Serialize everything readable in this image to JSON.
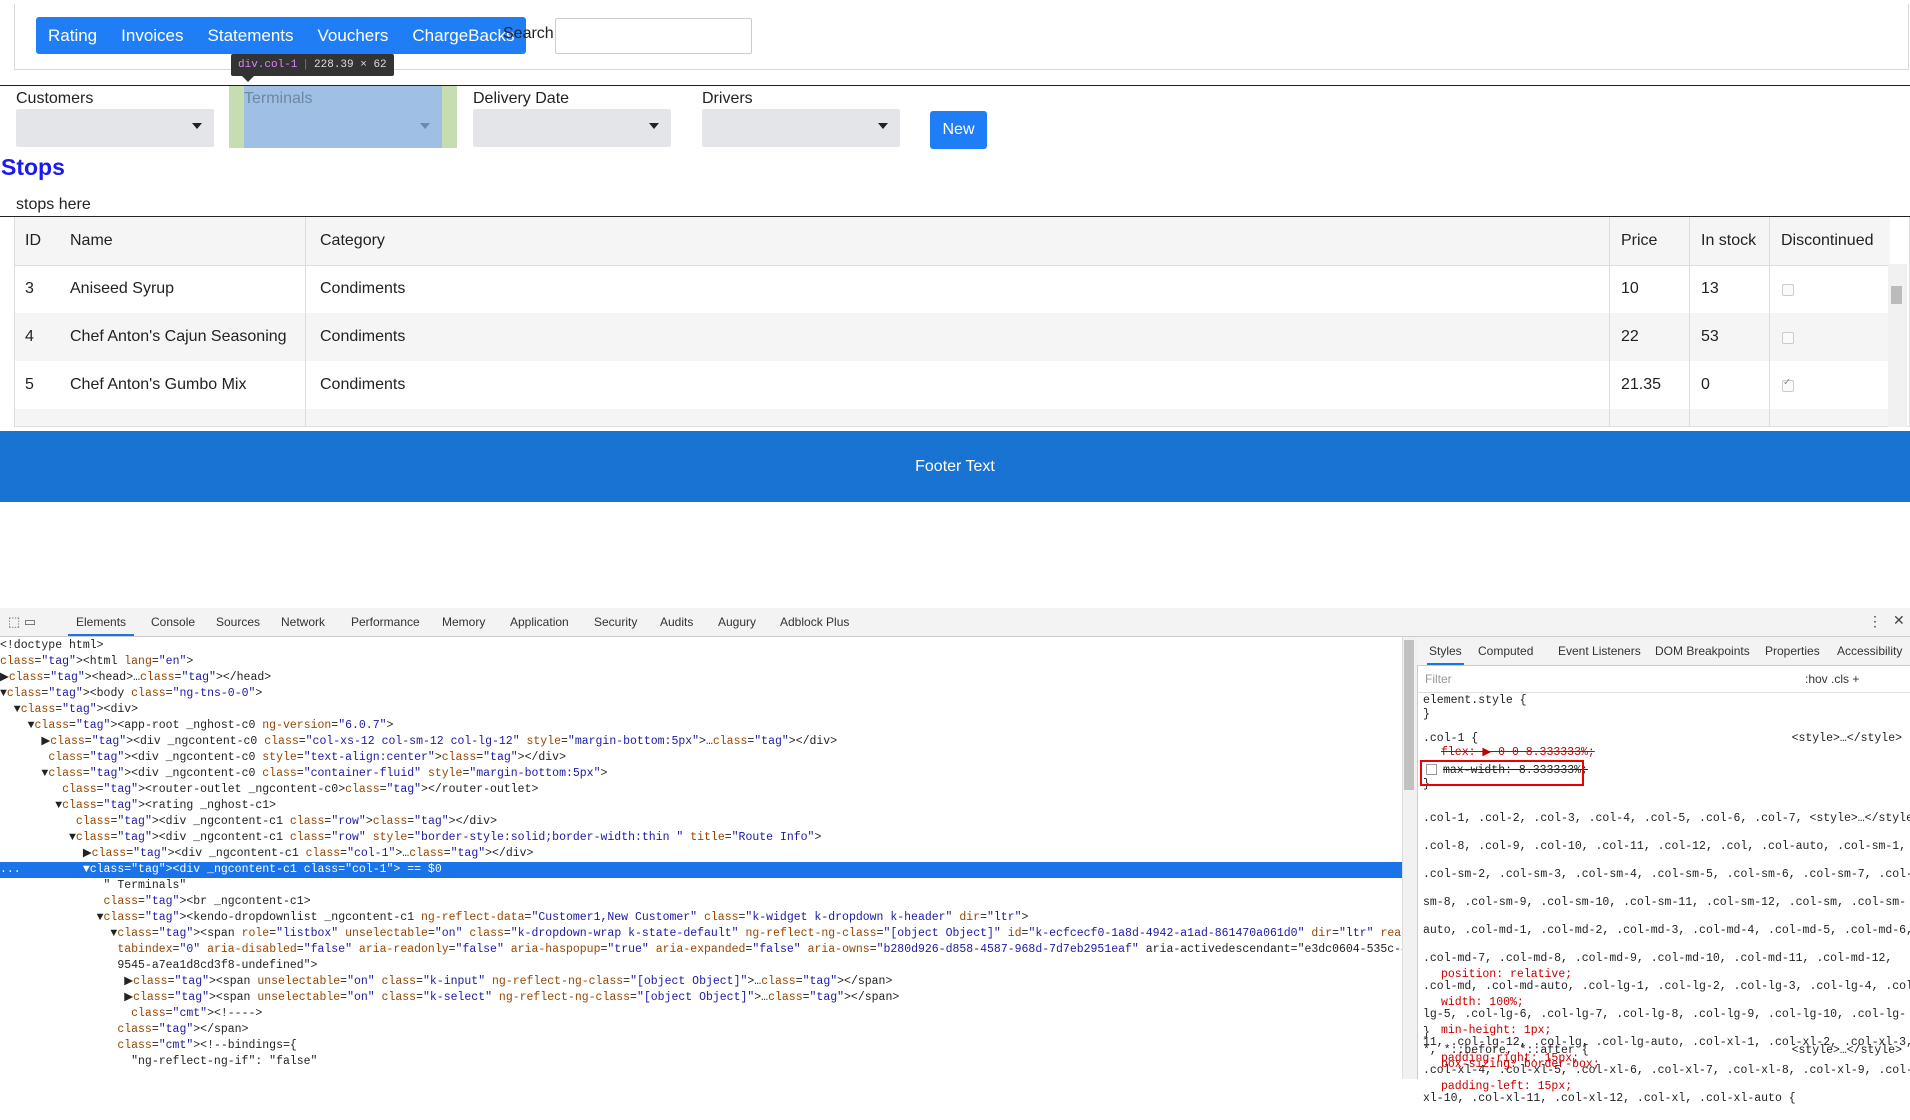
{
  "nav": {
    "items": [
      "Rating",
      "Invoices",
      "Statements",
      "Vouchers",
      "ChargeBacks"
    ],
    "search_label": "Search",
    "search_value": ""
  },
  "tooltip": {
    "selector": "div.col-1",
    "size": "228.39 × 62"
  },
  "filters": {
    "customers": "Customers",
    "terminals": "Terminals",
    "delivery_date": "Delivery Date",
    "drivers": "Drivers",
    "new_button": "New"
  },
  "stops": {
    "title": "Stops",
    "text": "stops here"
  },
  "grid": {
    "columns": [
      "ID",
      "Name",
      "Category",
      "Price",
      "In stock",
      "Discontinued"
    ],
    "rows": [
      {
        "id": "3",
        "name": "Aniseed Syrup",
        "category": "Condiments",
        "price": "10",
        "stock": "13",
        "discontinued": false
      },
      {
        "id": "4",
        "name": "Chef Anton's Cajun Seasoning",
        "category": "Condiments",
        "price": "22",
        "stock": "53",
        "discontinued": false
      },
      {
        "id": "5",
        "name": "Chef Anton's Gumbo Mix",
        "category": "Condiments",
        "price": "21.35",
        "stock": "0",
        "discontinued": true
      }
    ]
  },
  "footer": {
    "text": "Footer Text"
  },
  "devtools": {
    "tabs": [
      "Elements",
      "Console",
      "Sources",
      "Network",
      "Performance",
      "Memory",
      "Application",
      "Security",
      "Audits",
      "Augury",
      "Adblock Plus"
    ],
    "styles_tabs": [
      "Styles",
      "Computed",
      "Event Listeners",
      "DOM Breakpoints",
      "Properties",
      "Accessibility"
    ],
    "filter_placeholder": "Filter",
    "hov_cls": ":hov  .cls  +",
    "elements": [
      "<!doctype html>",
      "<html lang=\"en\">",
      "▶<head>…</head>",
      "▼<body class=\"ng-tns-0-0\">",
      "  ▼<div>",
      "    ▼<app-root _nghost-c0 ng-version=\"6.0.7\">",
      "      ▶<div _ngcontent-c0 class=\"col-xs-12 col-sm-12 col-lg-12\" style=\"margin-bottom:5px\">…</div>",
      "       <div _ngcontent-c0 style=\"text-align:center\"></div>",
      "      ▼<div _ngcontent-c0 class=\"container-fluid\" style=\"margin-bottom:5px\">",
      "         <router-outlet _ngcontent-c0></router-outlet>",
      "        ▼<rating _nghost-c1>",
      "           <div _ngcontent-c1 class=\"row\"></div>",
      "          ▼<div _ngcontent-c1 class=\"row\" style=\"border-style:solid;border-width:thin \" title=\"Route Info\">",
      "            ▶<div _ngcontent-c1 class=\"col-1\">…</div>",
      "...         ▼<div _ngcontent-c1 class=\"col-1\"> == $0",
      "               \" Terminals\"",
      "               <br _ngcontent-c1>",
      "              ▼<kendo-dropdownlist _ngcontent-c1 ng-reflect-data=\"Customer1,New Customer\" class=\"k-widget k-dropdown k-header\" dir=\"ltr\">",
      "                ▼<span role=\"listbox\" unselectable=\"on\" class=\"k-dropdown-wrap k-state-default\" ng-reflect-ng-class=\"[object Object]\" id=\"k-ecfcecf0-1a8d-4942-a1ad-861470a061d0\" dir=\"ltr\" readonly=\"false\"",
      "                 tabindex=\"0\" aria-disabled=\"false\" aria-readonly=\"false\" aria-haspopup=\"true\" aria-expanded=\"false\" aria-owns=\"b280d926-d858-4587-968d-7d7eb2951eaf\" aria-activedescendant=\"e3dc0604-535c-436a-",
      "                 9545-a7ea1d8cd3f8-undefined\">",
      "                  ▶<span unselectable=\"on\" class=\"k-input\" ng-reflect-ng-class=\"[object Object]\">…</span>",
      "                  ▶<span unselectable=\"on\" class=\"k-select\" ng-reflect-ng-class=\"[object Object]\">…</span>",
      "                   <!---->",
      "                 </span>",
      "                 <!--bindings={",
      "                   \"ng-reflect-ng-if\": \"false\""
    ],
    "styles": {
      "element_style": "element.style {",
      "close": "}",
      "col1_selector": ".col-1 {",
      "col1_src": "<style>…</style>",
      "flex": "flex: ▶ 0 0 8.333333%;",
      "max_width": "max-width: 8.333333%;",
      "big_selector": [
        ".col-1, .col-2, .col-3, .col-4, .col-5, .col-6, .col-7, <style>…</style>",
        ".col-8, .col-9, .col-10, .col-11, .col-12, .col, .col-auto, .col-sm-1,",
        ".col-sm-2, .col-sm-3, .col-sm-4, .col-sm-5, .col-sm-6, .col-sm-7, .col-",
        "sm-8, .col-sm-9, .col-sm-10, .col-sm-11, .col-sm-12, .col-sm, .col-sm-",
        "auto, .col-md-1, .col-md-2, .col-md-3, .col-md-4, .col-md-5, .col-md-6,",
        ".col-md-7, .col-md-8, .col-md-9, .col-md-10, .col-md-11, .col-md-12,",
        ".col-md, .col-md-auto, .col-lg-1, .col-lg-2, .col-lg-3, .col-lg-4, .col-",
        "lg-5, .col-lg-6, .col-lg-7, .col-lg-8, .col-lg-9, .col-lg-10, .col-lg-",
        "11, .col-lg-12, .col-lg, .col-lg-auto, .col-xl-1, .col-xl-2, .col-xl-3,",
        ".col-xl-4, .col-xl-5, .col-xl-6, .col-xl-7, .col-xl-8, .col-xl-9, .col-",
        "xl-10, .col-xl-11, .col-xl-12, .col-xl, .col-xl-auto {"
      ],
      "props": [
        "position: relative;",
        "width: 100%;",
        "min-height: 1px;",
        "padding-right: 15px;",
        "padding-left: 15px;"
      ],
      "universal": "*, *::before, *::after {",
      "universal_src": "<style>…</style>",
      "box_sizing": "box-sizing: border-box;"
    }
  }
}
